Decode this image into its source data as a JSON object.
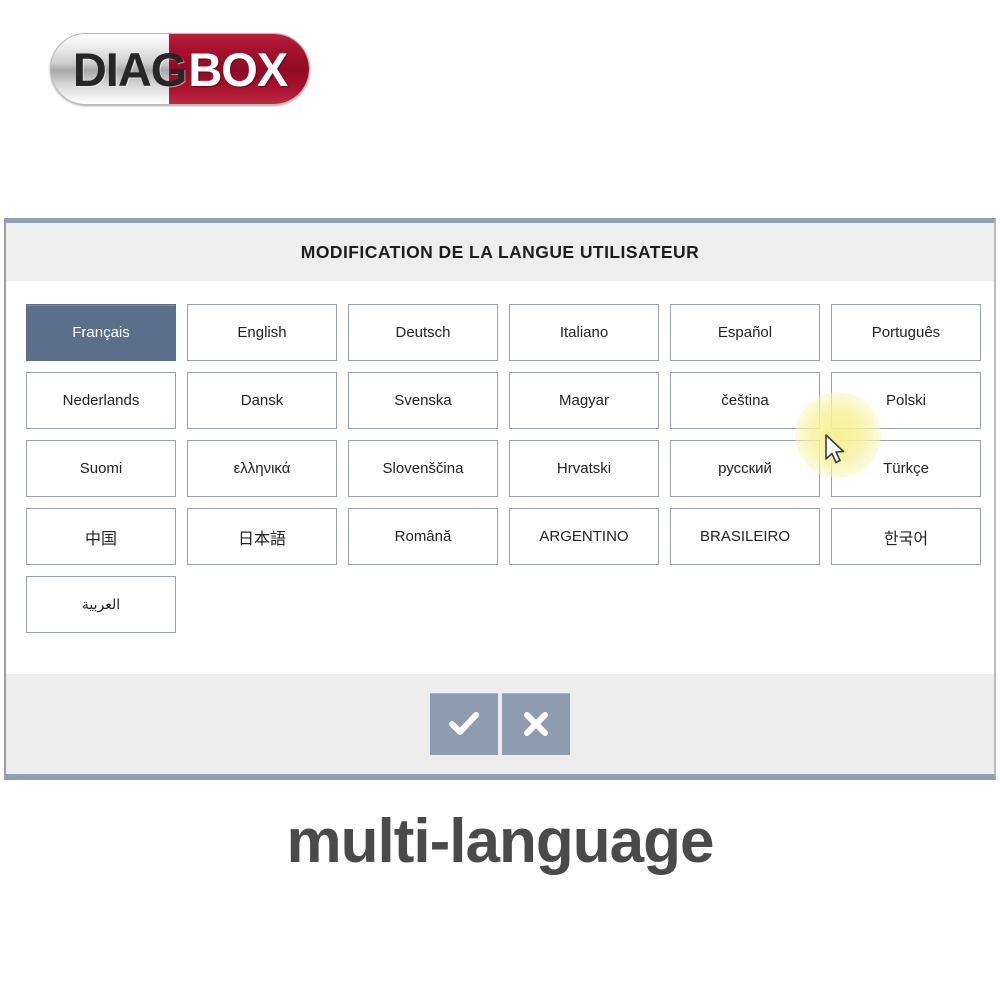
{
  "logo": {
    "text_left": "DIAG",
    "text_right": "BOX",
    "color_left_bg": "#d0d0d0",
    "color_right_bg": "#9c0f2a",
    "color_left_text": "#262626",
    "color_right_text": "#ffffff"
  },
  "dialog": {
    "title": "MODIFICATION DE LA LANGUE UTILISATEUR",
    "accent_color": "#8f9fb4",
    "selected_color": "#5b6e8a",
    "languages": [
      {
        "label": "Français",
        "selected": true,
        "script": "latin"
      },
      {
        "label": "English",
        "selected": false,
        "script": "latin"
      },
      {
        "label": "Deutsch",
        "selected": false,
        "script": "latin"
      },
      {
        "label": "Italiano",
        "selected": false,
        "script": "latin"
      },
      {
        "label": "Español",
        "selected": false,
        "script": "latin"
      },
      {
        "label": "Português",
        "selected": false,
        "script": "latin"
      },
      {
        "label": "Nederlands",
        "selected": false,
        "script": "latin"
      },
      {
        "label": "Dansk",
        "selected": false,
        "script": "latin"
      },
      {
        "label": "Svenska",
        "selected": false,
        "script": "latin"
      },
      {
        "label": "Magyar",
        "selected": false,
        "script": "latin"
      },
      {
        "label": "čeština",
        "selected": false,
        "script": "latin"
      },
      {
        "label": "Polski",
        "selected": false,
        "script": "latin"
      },
      {
        "label": "Suomi",
        "selected": false,
        "script": "latin"
      },
      {
        "label": "ελληνικά",
        "selected": false,
        "script": "greek"
      },
      {
        "label": "Slovenščina",
        "selected": false,
        "script": "latin"
      },
      {
        "label": "Hrvatski",
        "selected": false,
        "script": "latin"
      },
      {
        "label": "русский",
        "selected": false,
        "script": "cyrillic"
      },
      {
        "label": "Türkçe",
        "selected": false,
        "script": "latin"
      },
      {
        "label": "中国",
        "selected": false,
        "script": "cjk"
      },
      {
        "label": "日本語",
        "selected": false,
        "script": "cjk"
      },
      {
        "label": "Română",
        "selected": false,
        "script": "latin"
      },
      {
        "label": "ARGENTINO",
        "selected": false,
        "script": "latin"
      },
      {
        "label": "BRASILEIRO",
        "selected": false,
        "script": "latin"
      },
      {
        "label": "한국어",
        "selected": false,
        "script": "cjk"
      },
      {
        "label": "العربية",
        "selected": false,
        "script": "rtl"
      }
    ],
    "footer": {
      "confirm_icon": "check-icon",
      "cancel_icon": "close-icon",
      "button_color": "#8e9cb0"
    }
  },
  "cursor": {
    "icon": "arrow-pointer-icon",
    "highlight_color": "#f6f08c"
  },
  "caption": {
    "text": "multi-language",
    "color": "#4a4a4a"
  }
}
